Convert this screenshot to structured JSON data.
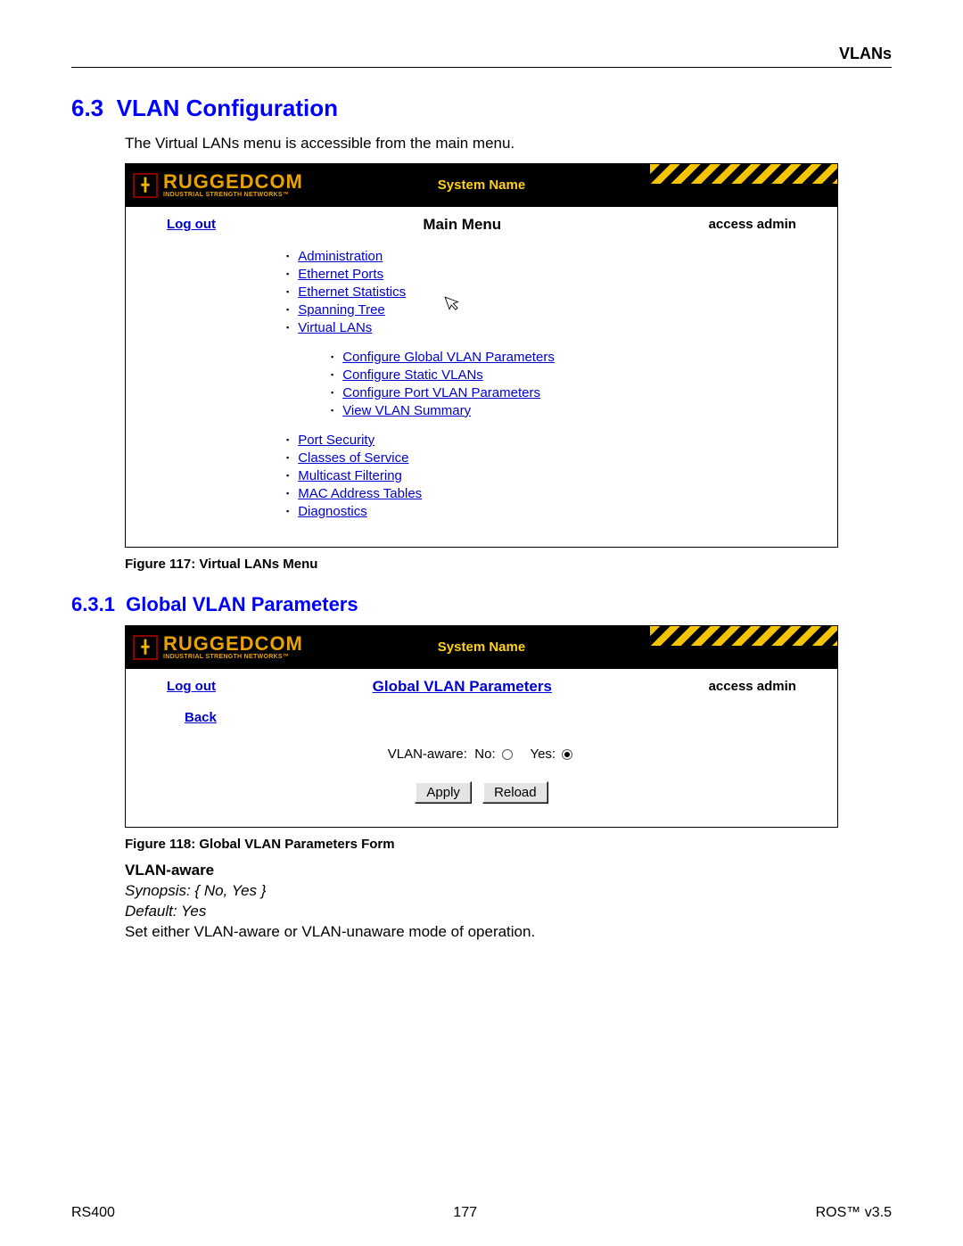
{
  "page_header": "VLANs",
  "section": {
    "number": "6.3",
    "title": "VLAN Configuration",
    "intro": "The Virtual LANs menu is accessible from the main menu."
  },
  "screenshot1": {
    "brand": "RUGGEDCOM",
    "tagline": "INDUSTRIAL STRENGTH NETWORKS™",
    "system_name": "System Name",
    "logout": "Log out",
    "title": "Main Menu",
    "access": "access admin",
    "menu": {
      "group1": [
        "Administration",
        "Ethernet Ports",
        "Ethernet Statistics",
        "Spanning Tree",
        "Virtual LANs"
      ],
      "sub": [
        "Configure Global VLAN Parameters",
        "Configure Static VLANs",
        "Configure Port VLAN Parameters",
        "View VLAN Summary"
      ],
      "group2": [
        "Port Security",
        "Classes of Service",
        "Multicast Filtering",
        "MAC Address Tables",
        "Diagnostics"
      ]
    }
  },
  "figure1_caption": "Figure 117: Virtual LANs Menu",
  "subsection": {
    "number": "6.3.1",
    "title": "Global VLAN Parameters"
  },
  "screenshot2": {
    "brand": "RUGGEDCOM",
    "tagline": "INDUSTRIAL STRENGTH NETWORKS™",
    "system_name": "System Name",
    "logout": "Log out",
    "title": "Global VLAN Parameters",
    "access": "access admin",
    "back": "Back",
    "field_label": "VLAN-aware:",
    "no_label": "No:",
    "yes_label": "Yes:",
    "selected": "yes",
    "apply": "Apply",
    "reload": "Reload"
  },
  "figure2_caption": "Figure 118: Global VLAN Parameters Form",
  "param": {
    "name": "VLAN-aware",
    "synopsis": "Synopsis: { No, Yes }",
    "default": "Default: Yes",
    "desc": "Set either VLAN-aware or VLAN-unaware mode of operation."
  },
  "footer": {
    "left": "RS400",
    "center": "177",
    "right": "ROS™  v3.5"
  }
}
